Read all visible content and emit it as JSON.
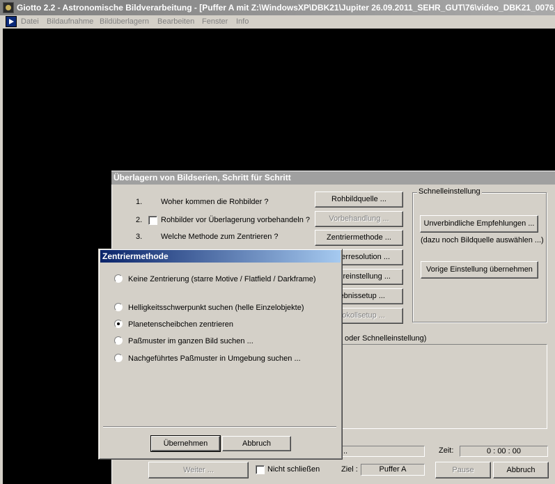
{
  "window": {
    "title": "Giotto 2.2 - Astronomische Bildverarbeitung - [Puffer A mit Z:\\WindowsXP\\DBK21\\Jupiter 26.09.2011_SEHR_GUT\\76\\video_DBK21_0076_"
  },
  "menu": [
    "Datei",
    "Bildaufnahme",
    "Bildüberlagern",
    "Bearbeiten",
    "Fenster",
    "Info"
  ],
  "wizard": {
    "title": "Überlagern von Bildserien, Schritt für Schritt",
    "steps": [
      {
        "num": "1.",
        "text": "Woher kommen die Rohbilder ?"
      },
      {
        "num": "2.",
        "text": "Rohbilder vor Überlagerung vorbehandeln ?"
      },
      {
        "num": "3.",
        "text": "Welche Methode zum Zentrieren ?"
      }
    ],
    "buttons": {
      "rohbildquelle": "Rohbildquelle ...",
      "vorbehandlung": "Vorbehandlung ...",
      "zentriermethode": "Zentriermethode ...",
      "resolution": "erresolution ...",
      "einstellung": "ereinstellung ...",
      "ergebnis": "ebnissetup ...",
      "protokoll": "tokollsetup ..."
    },
    "schnell": {
      "label": "Schnelleinstellung",
      "empfehlungen": "Unverbindliche Empfehlungen ...",
      "hint": "(dazu noch Bildquelle auswählen ...)",
      "vorige": "Vorige Einstellung übernehmen"
    },
    "info_text": "oder Schnelleinstellung)",
    "progress_text": "..",
    "zeit_label": "Zeit:",
    "zeit_value": "0 : 00 : 00",
    "weiter": "Weiter ...",
    "nicht_schliessen": "Nicht schließen",
    "ziel_label": "Ziel :",
    "ziel_value": "Puffer A",
    "pause": "Pause",
    "abbruch": "Abbruch"
  },
  "zentrier": {
    "title": "Zentriermethode",
    "options": [
      {
        "label": "Keine Zentrierung (starre Motive / Flatfield / Darkframe)",
        "checked": false
      },
      {
        "label": "Helligkeitsschwerpunkt suchen (helle Einzelobjekte)",
        "checked": false
      },
      {
        "label": "Planetenscheibchen zentrieren",
        "checked": true
      },
      {
        "label": "Paßmuster im ganzen Bild suchen ...",
        "checked": false
      },
      {
        "label": "Nachgeführtes Paßmuster in Umgebung suchen ...",
        "checked": false
      }
    ],
    "ok": "Übernehmen",
    "cancel": "Abbruch"
  }
}
